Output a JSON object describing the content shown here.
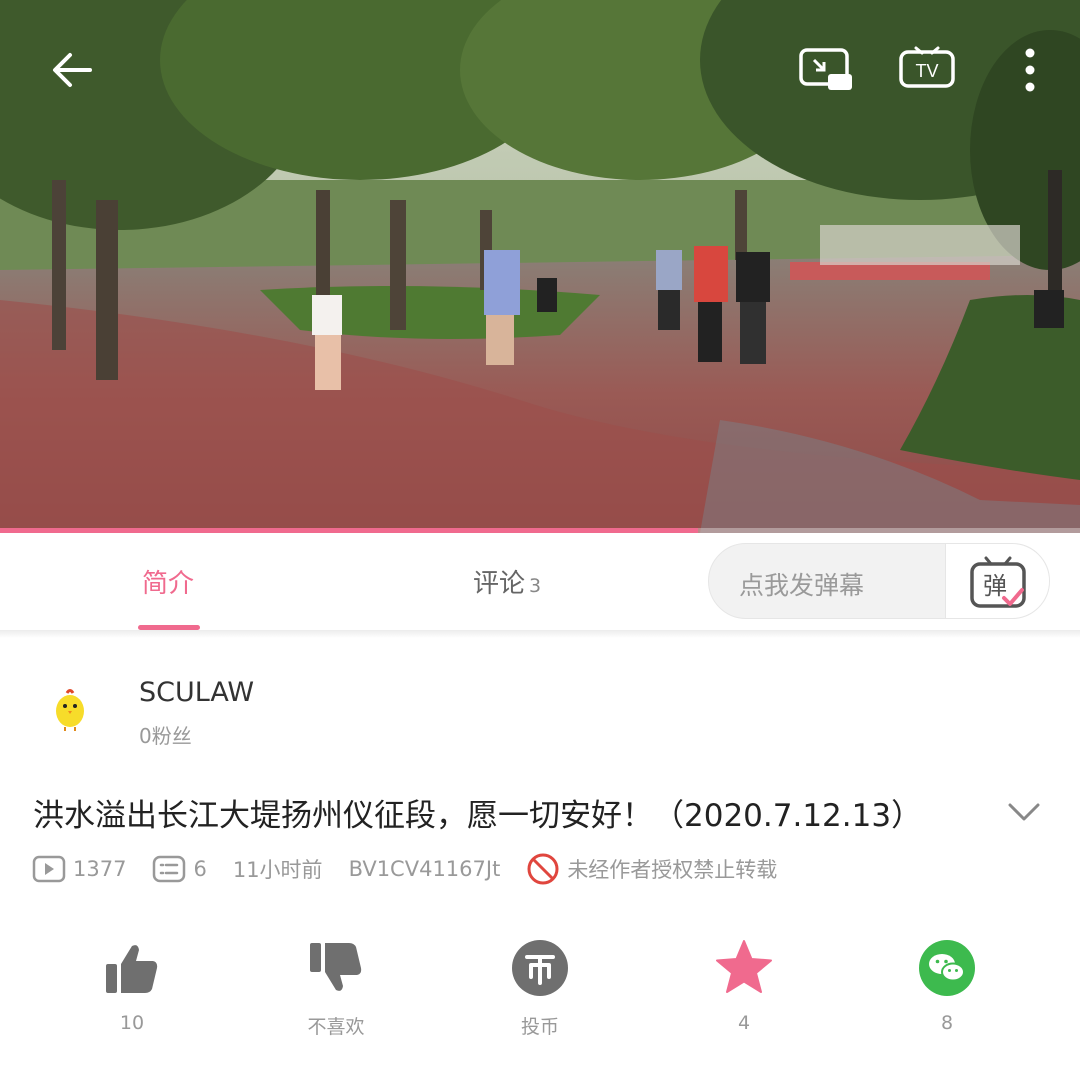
{
  "video": {
    "progress": 0.646,
    "icons": [
      "back-arrow-icon",
      "picture-in-picture-icon",
      "tv-cast-icon",
      "more-icon"
    ],
    "tv_label": "TV"
  },
  "tabs": [
    {
      "label": "简介",
      "active": true
    },
    {
      "label": "评论",
      "count": "3",
      "active": false
    }
  ],
  "danmaku": {
    "placeholder": "点我发弹幕",
    "button_glyph": "弹"
  },
  "uploader": {
    "name": "SCULAW",
    "fans": "0粉丝",
    "avatar_icon": "yellow-chick-icon"
  },
  "title": "洪水溢出长江大堤扬州仪征段，愿一切安好！（2020.7.12.13）",
  "meta": {
    "views": "1377",
    "danmaku_count": "6",
    "time": "11小时前",
    "bvid": "BV1CV41167Jt",
    "copyright": "未经作者授权禁止转载"
  },
  "actions": [
    {
      "id": "like",
      "label": "10",
      "icon": "thumbs-up-icon"
    },
    {
      "id": "dislike",
      "label": "不喜欢",
      "icon": "thumbs-down-icon"
    },
    {
      "id": "coin",
      "label": "投币",
      "icon": "coin-icon"
    },
    {
      "id": "favorite",
      "label": "4",
      "icon": "star-icon"
    },
    {
      "id": "share",
      "label": "8",
      "icon": "wechat-icon"
    }
  ],
  "colors": {
    "accent": "#f06a8e",
    "icon_gray": "#6f6f6f",
    "wechat_green": "#3dba4e"
  }
}
